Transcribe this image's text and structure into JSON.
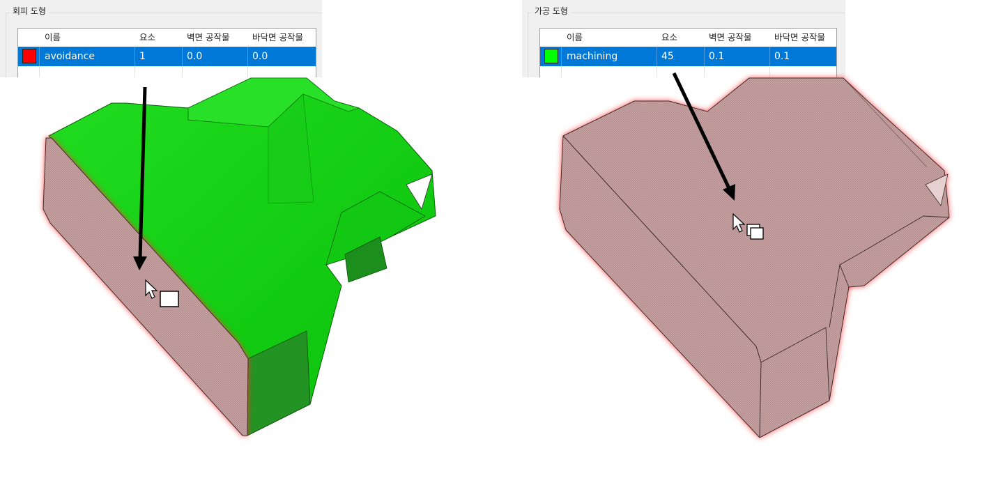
{
  "left_panel": {
    "title": "회피 도형",
    "columns": [
      "이름",
      "요소",
      "벽면 공작물",
      "바닥면 공작물"
    ],
    "row": {
      "color": "#ff0000",
      "name": "avoidance",
      "elements": "1",
      "wall": "0.0",
      "floor": "0.0"
    }
  },
  "right_panel": {
    "title": "가공 도형",
    "columns": [
      "이름",
      "요소",
      "벽면 공작물",
      "바닥면 공작물"
    ],
    "row": {
      "color": "#00ff00",
      "name": "machining",
      "elements": "45",
      "wall": "0.1",
      "floor": "0.1"
    }
  },
  "colors": {
    "selection": "#0078d7",
    "avoidance_highlight": "#ff0000",
    "machining_highlight": "#00e000",
    "model_surface": "#c9a0a0"
  }
}
